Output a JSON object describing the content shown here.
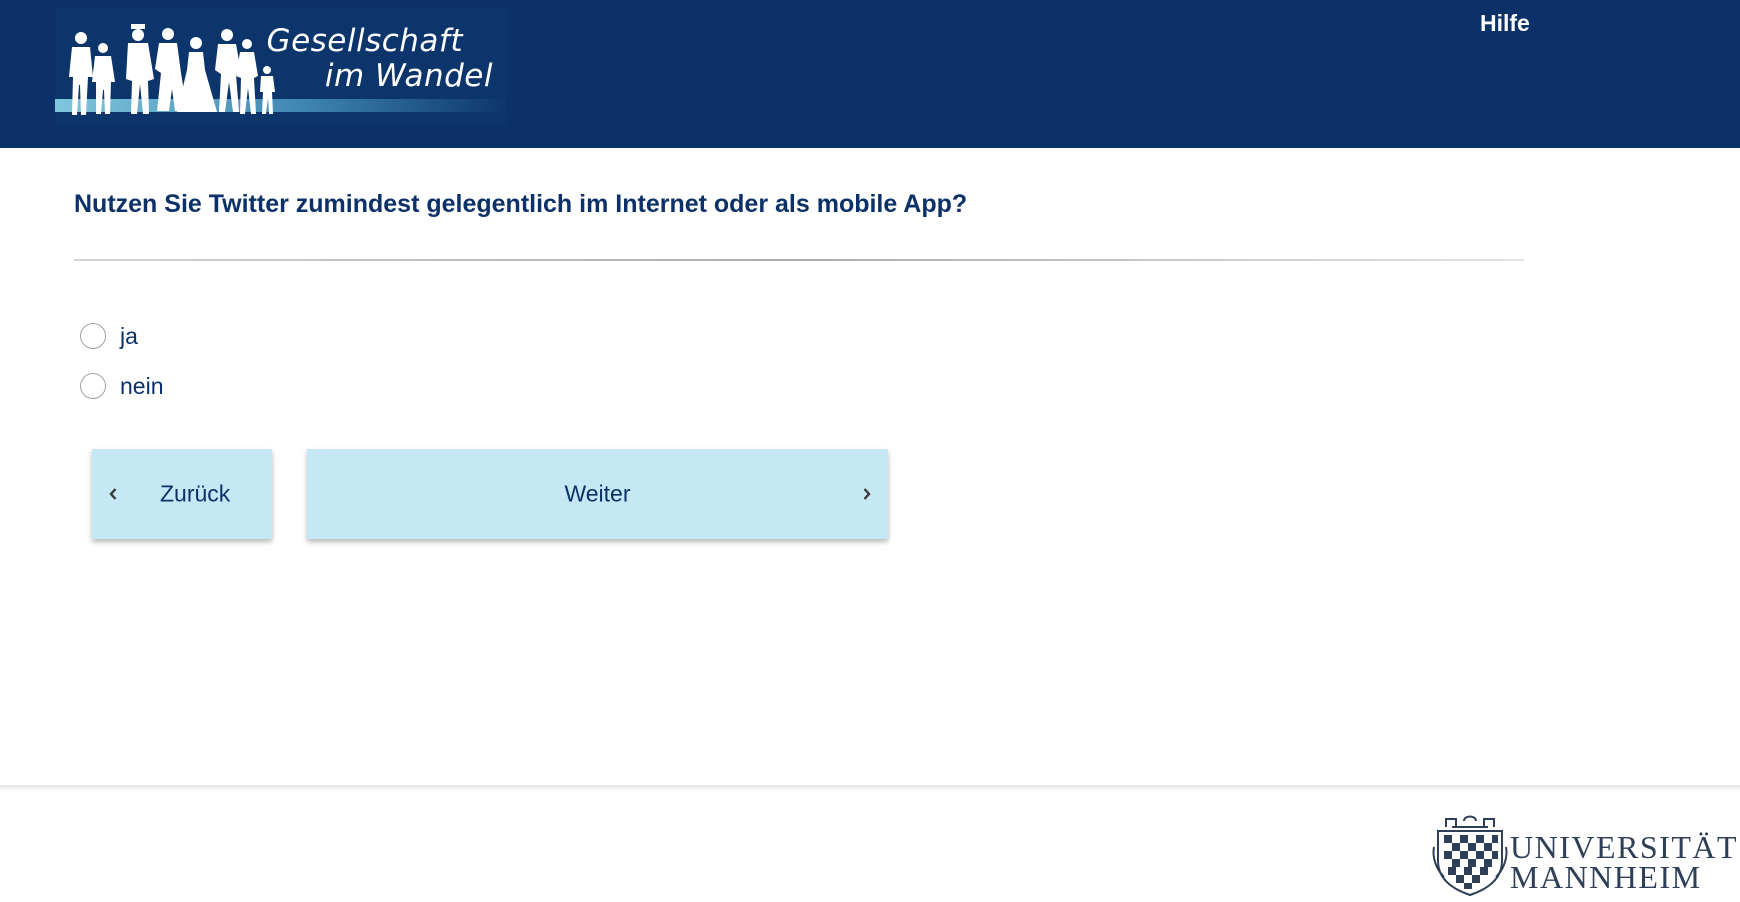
{
  "header": {
    "logo": {
      "line1": "Gesellschaft",
      "line2": "im Wandel",
      "icon": "people-silhouettes-icon"
    },
    "help_label": "Hilfe"
  },
  "question": {
    "text": "Nutzen Sie Twitter zumindest gelegentlich im Internet oder als mobile App?",
    "options": [
      {
        "label": "ja",
        "selected": false
      },
      {
        "label": "nein",
        "selected": false
      }
    ]
  },
  "navigation": {
    "back_label": "Zurück",
    "next_label": "Weiter",
    "back_icon": "chevron-left-icon",
    "next_icon": "chevron-right-icon"
  },
  "footer": {
    "university_line1": "UNIVERSITÄT",
    "university_line2": "MANNHEIM",
    "crest_icon": "university-crest-icon"
  },
  "colors": {
    "header_bg": "#0b3168",
    "button_bg": "#c6e7f4",
    "text_primary": "#0b3168"
  }
}
